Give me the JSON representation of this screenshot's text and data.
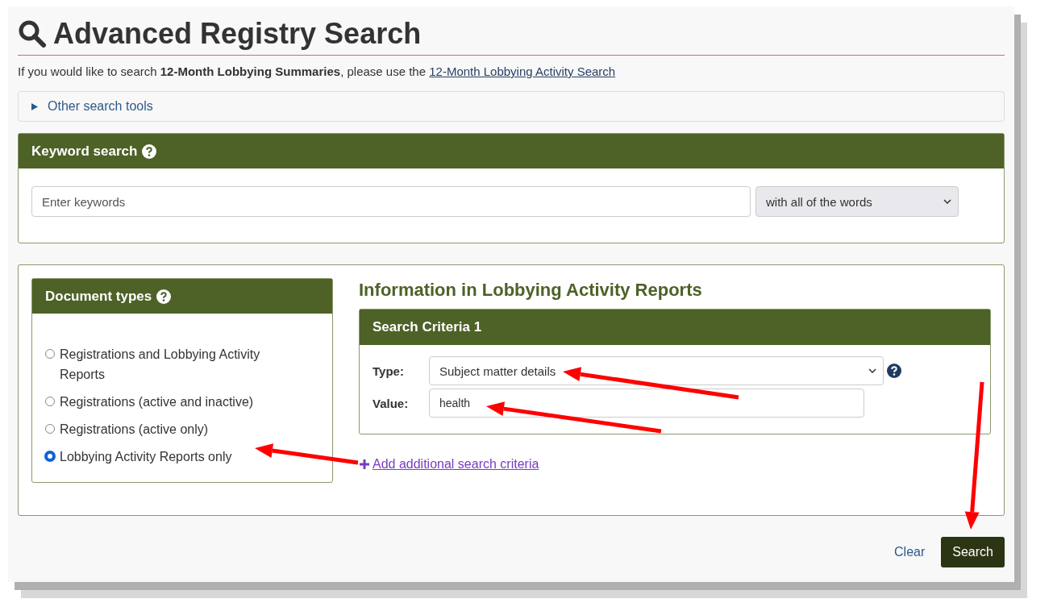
{
  "page": {
    "title": "Advanced Registry Search",
    "intro": "If you would like to search **12-Month Lobbying Summaries**, please use the",
    "intro_link": "12-Month Lobbying Activity Search",
    "other_tools": {
      "label": "Other search tools",
      "expanded": false
    }
  },
  "keyword_search": {
    "title": "Keyword search",
    "placeholder": "Enter keywords",
    "match_mode": "with all of the words"
  },
  "document_types": {
    "title": "Document types",
    "options": [
      {
        "label": "Registrations and Lobbying Activity Reports",
        "selected": false
      },
      {
        "label": "Registrations (active and inactive)",
        "selected": false
      },
      {
        "label": "Registrations (active only)",
        "selected": false
      },
      {
        "label": "Lobbying Activity Reports only",
        "selected": true
      }
    ]
  },
  "criteria_section": {
    "heading": "Information in Lobbying Activity Reports",
    "criteria": [
      {
        "title": "Search Criteria 1",
        "type_label": "Type:",
        "type_value": "Subject matter details",
        "value_label": "Value:",
        "value": "health"
      }
    ],
    "add_link": "Add additional search criteria"
  },
  "actions": [
    {
      "label": "Clear",
      "kind": "link"
    },
    {
      "label": "Search",
      "kind": "primary"
    }
  ]
}
